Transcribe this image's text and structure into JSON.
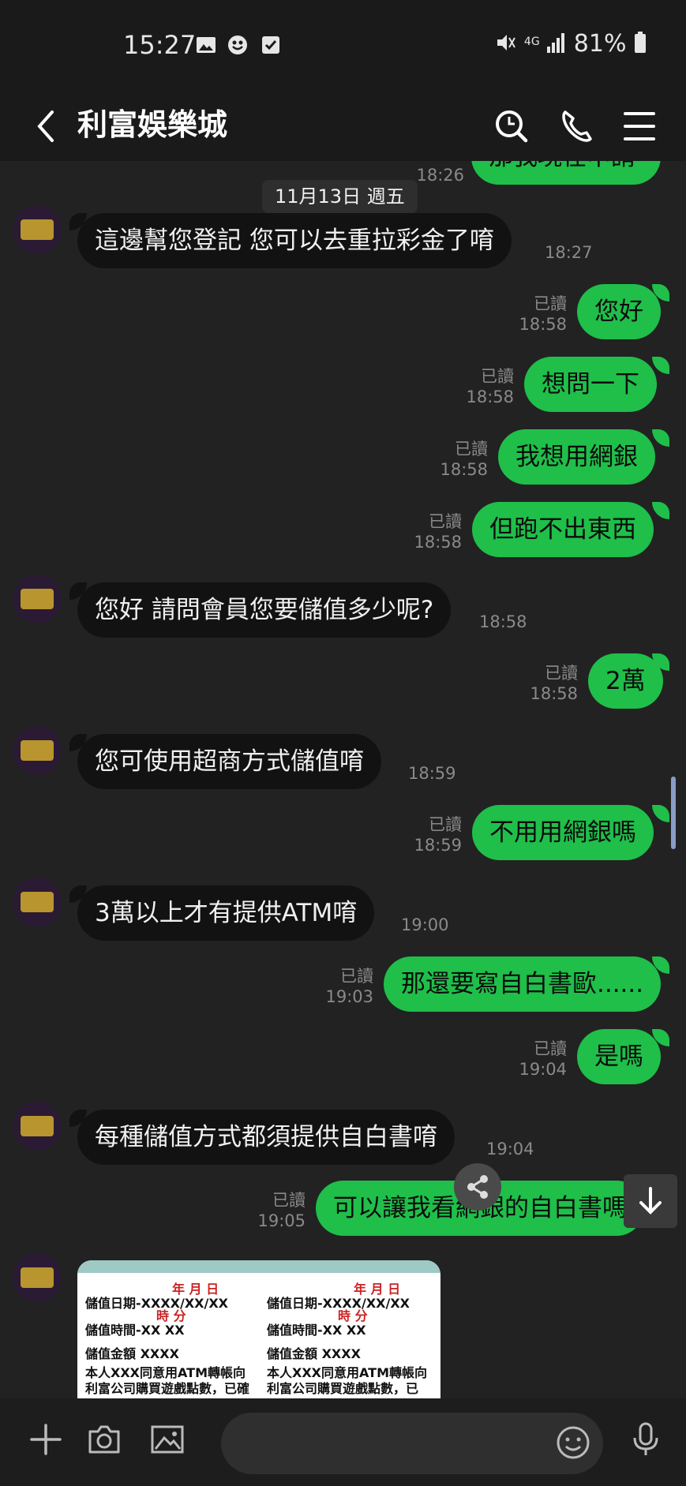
{
  "status_bar": {
    "time": "15:27",
    "battery": "81%",
    "network": "4G",
    "icons": [
      "gallery-icon",
      "smiley-notification-icon",
      "checkbox-notification-icon",
      "mute-icon",
      "signal-icon",
      "battery-icon"
    ]
  },
  "header": {
    "title": "利富娛樂城",
    "icons": [
      "back-icon",
      "search-icon",
      "phone-icon",
      "menu-icon"
    ]
  },
  "chat": {
    "partial_top": {
      "text": "那我現在申請",
      "time": "18:26"
    },
    "date_divider": "11月13日 週五",
    "read_label": "已讀",
    "messages": [
      {
        "dir": "in",
        "text": "這邊幫您登記 您可以去重拉彩金了唷",
        "time": "18:27"
      },
      {
        "dir": "out",
        "text": "您好",
        "time": "18:58"
      },
      {
        "dir": "out",
        "text": "想問一下",
        "time": "18:58"
      },
      {
        "dir": "out",
        "text": "我想用網銀",
        "time": "18:58"
      },
      {
        "dir": "out",
        "text": "但跑不出東西",
        "time": "18:58"
      },
      {
        "dir": "in",
        "text": "您好 請問會員您要儲值多少呢?",
        "time": "18:58"
      },
      {
        "dir": "out",
        "text": "2萬",
        "time": "18:58"
      },
      {
        "dir": "in",
        "text": "您可使用超商方式儲值唷",
        "time": "18:59"
      },
      {
        "dir": "out",
        "text": "不用用網銀嗎",
        "time": "18:59"
      },
      {
        "dir": "in",
        "text": "3萬以上才有提供ATM唷",
        "time": "19:00"
      },
      {
        "dir": "out",
        "text": "那還要寫自白書歐......",
        "time": "19:03"
      },
      {
        "dir": "out",
        "text": "是嗎",
        "time": "19:04"
      },
      {
        "dir": "in",
        "text": "每種儲值方式都須提供自白書唷",
        "time": "19:04"
      },
      {
        "dir": "out",
        "text": "可以讓我看網銀的自白書嗎",
        "time": "19:05"
      }
    ],
    "image_preview": {
      "left": {
        "date_row": "年  月  日",
        "line1": "儲值日期-XXXX/XX/XX",
        "time_row": "時  分",
        "line2": "儲值時間-XX XX",
        "line3": "儲值金額 XXXX",
        "line4": "本人XXX同意用ATM轉帳向",
        "line5": "利富公司購買遊戲點數，已確"
      },
      "right": {
        "date_row": "年  月  日",
        "line1": "儲值日期-XXXX/XX/XX",
        "time_row": "時  分",
        "line2": "儲值時間-XX XX",
        "line3": "儲值金額 XXXX",
        "line4": "本人XXX同意用ATM轉帳向",
        "line5": "利富公司購買遊戲點數，已"
      }
    }
  },
  "input_bar": {
    "icons": [
      "plus-icon",
      "camera-icon",
      "image-icon",
      "emoji-icon",
      "microphone-icon"
    ]
  },
  "colors": {
    "outgoing_bubble": "#1fbf4a",
    "incoming_bubble": "#121212",
    "background": "#222222",
    "header": "#1a1a1a"
  }
}
